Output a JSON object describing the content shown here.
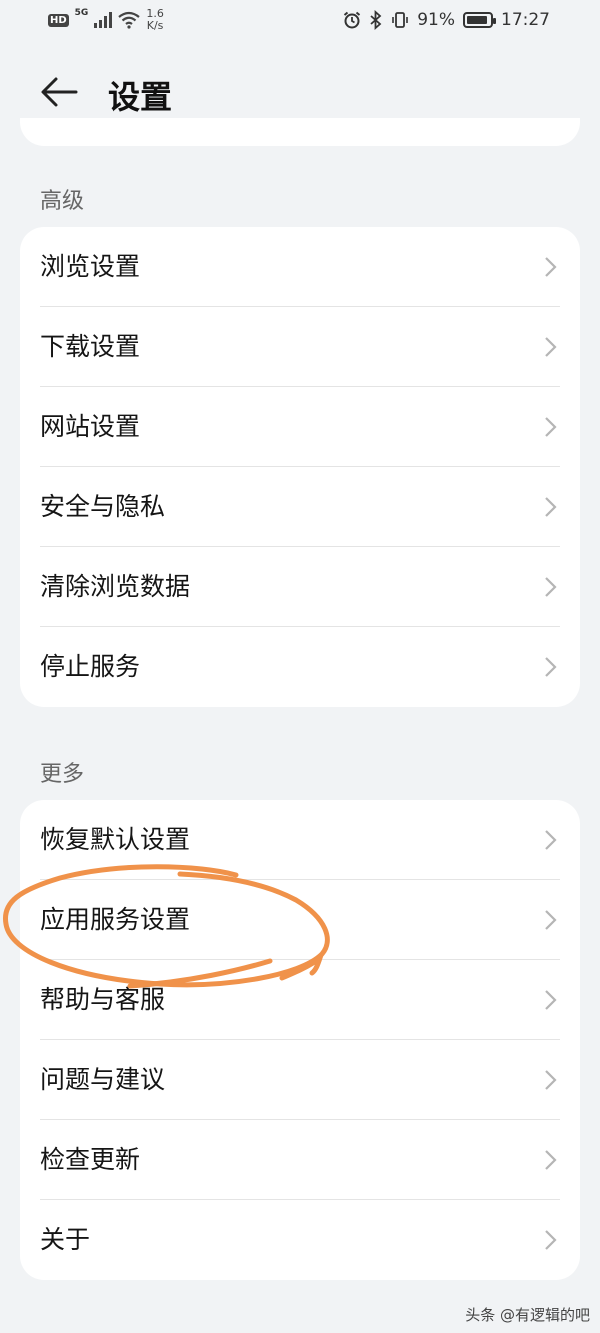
{
  "status_bar": {
    "hd": "HD",
    "network": "5G",
    "speed_value": "1.6",
    "speed_unit": "K/s",
    "battery_percent": "91%",
    "battery_level": 0.91,
    "time": "17:27"
  },
  "header": {
    "title": "设置",
    "back_icon": "back-arrow-icon"
  },
  "sections": [
    {
      "title": "高级",
      "items": [
        {
          "label": "浏览设置"
        },
        {
          "label": "下载设置"
        },
        {
          "label": "网站设置"
        },
        {
          "label": "安全与隐私"
        },
        {
          "label": "清除浏览数据"
        },
        {
          "label": "停止服务"
        }
      ]
    },
    {
      "title": "更多",
      "items": [
        {
          "label": "恢复默认设置"
        },
        {
          "label": "应用服务设置"
        },
        {
          "label": "帮助与客服"
        },
        {
          "label": "问题与建议"
        },
        {
          "label": "检查更新"
        },
        {
          "label": "关于"
        }
      ]
    }
  ],
  "annotation": {
    "highlighted_item": "应用服务设置",
    "color": "#f0924a"
  },
  "watermark": "头条 @有逻辑的吧",
  "colors": {
    "background": "#f1f3f5",
    "card": "#ffffff",
    "chevron": "#b5b5b5"
  }
}
